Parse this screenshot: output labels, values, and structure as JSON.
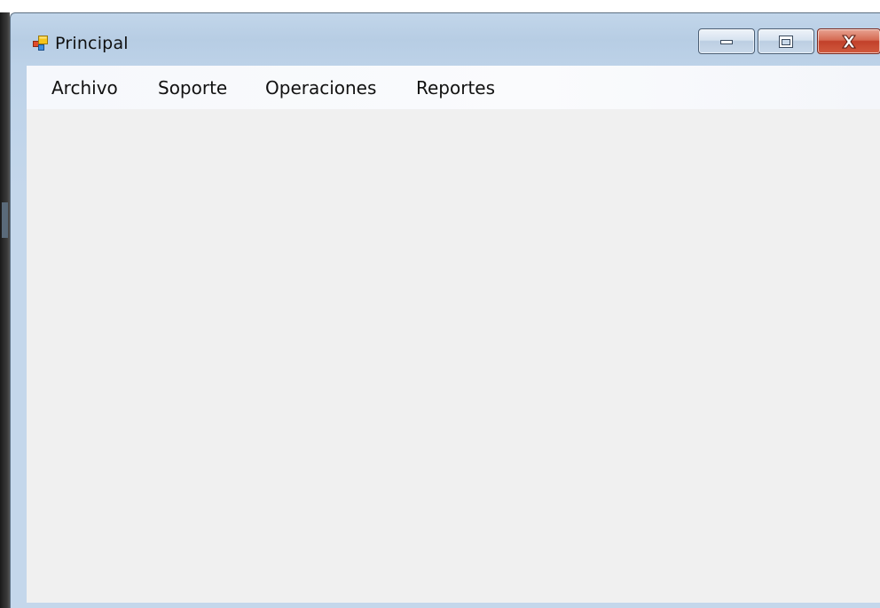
{
  "window": {
    "title": "Principal",
    "icon": "windows-forms-app-icon",
    "controls": {
      "minimize_icon": "minimize-icon",
      "maximize_icon": "maximize-icon",
      "close_icon": "close-icon"
    }
  },
  "menu": {
    "items": [
      {
        "label": "Archivo"
      },
      {
        "label": "Soporte"
      },
      {
        "label": "Operaciones"
      },
      {
        "label": "Reportes"
      }
    ]
  },
  "colors": {
    "titlebar": "#bdd2e8",
    "menubar": "#f6f8fc",
    "client": "#f0f0f0",
    "close_button": "#c2402a"
  }
}
